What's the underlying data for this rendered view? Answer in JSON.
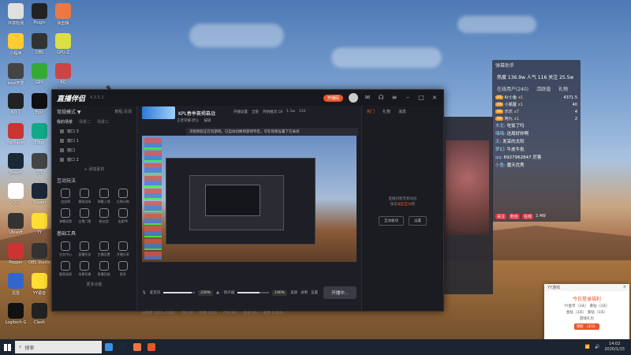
{
  "desktop": {
    "icons": [
      {
        "label": "环境检测",
        "color": "#e0e0e0"
      },
      {
        "label": "小程序",
        "color": "#ffcc33"
      },
      {
        "label": "Intel开发",
        "color": "#444"
      },
      {
        "label": "NO.1",
        "color": "#222"
      },
      {
        "label": "PotPlayer",
        "color": "#c33"
      },
      {
        "label": "Steam",
        "color": "#1b2838"
      },
      {
        "label": "QQ",
        "color": "#fff"
      },
      {
        "label": "Ubisoft",
        "color": "#333"
      },
      {
        "label": "Pepper",
        "color": "#c33"
      },
      {
        "label": "迅雷",
        "color": "#36c"
      },
      {
        "label": "Logitech G",
        "color": "#111"
      },
      {
        "label": "Plugin",
        "color": "#222"
      },
      {
        "label": "OBS",
        "color": "#333"
      },
      {
        "label": "GPU",
        "color": "#3a3"
      },
      {
        "label": "Epic",
        "color": "#111"
      },
      {
        "label": "Edge",
        "color": "#1a8"
      },
      {
        "label": "Q3",
        "color": "#444"
      },
      {
        "label": "Steam",
        "color": "#1b2838"
      },
      {
        "label": "YY",
        "color": "#ffdd33"
      },
      {
        "label": "OBS Studio",
        "color": "#333"
      },
      {
        "label": "YY语音",
        "color": "#ffdd33"
      },
      {
        "label": "Clash",
        "color": "#222"
      },
      {
        "label": "快剪辑",
        "color": "#e74"
      },
      {
        "label": "GPU-Z",
        "color": "#dd4"
      },
      {
        "label": "BG",
        "color": "#c44"
      },
      {
        "label": "3D",
        "color": "#333"
      },
      {
        "label": "Game",
        "color": "#c33"
      },
      {
        "label": "网易云音乐",
        "color": "#d33"
      },
      {
        "label": "直播姬",
        "color": "#3a8fe0"
      },
      {
        "label": "微信",
        "color": "#2a3"
      },
      {
        "label": "文档",
        "color": "#e74"
      }
    ]
  },
  "app": {
    "brand": "直播伴侣",
    "version": "4.3.5.2",
    "live_pill": "开播码",
    "left": {
      "section1_title": "常规模式 ▼",
      "section1_links": "教程 反馈",
      "tabs": [
        "我的场景",
        "场景二",
        "场景三"
      ],
      "scenes": [
        "窗口 3",
        "窗口 1",
        "窗口",
        "窗口 2"
      ],
      "add_source": "+ 添加素材",
      "section2_title": "互动玩法",
      "interact_tools": [
        "加加榜",
        "模拟战场",
        "弹幕上墙",
        "礼物计数",
        "弹幕投票",
        "全景门票",
        "粉丝团",
        "连麦PK"
      ],
      "section3_title": "基础工具",
      "basic_tools": [
        "任务中心",
        "直播任务",
        "主播设置",
        "开播分享",
        "截图录屏",
        "场景切换",
        "直播回放",
        "更多"
      ],
      "more": "更多功能"
    },
    "center": {
      "stream_name": "KPL春季赛揭幕战",
      "sub_info": [
        "王者荣耀·默认",
        "编辑"
      ],
      "stats": [
        "开播设置",
        "全部",
        "开始推流 18",
        "1.1w",
        "133"
      ],
      "notice": "识别到您正在玩游戏，已自动切换到游戏专区，可在场景设置下方关闭",
      "mic_label": "麦克风",
      "mic_value": "230%",
      "speaker_label": "扬声器",
      "speaker_value": "100%",
      "mic_level": 0.9,
      "speaker_level": 0.7,
      "ctrl_icons": [
        "美颜",
        "录制",
        "设置"
      ],
      "live_button": "开播中...",
      "status": [
        "分辨率 1920×1080",
        "FPS 60",
        "码率 2500",
        "CPU 8%",
        "丢帧 0%",
        "帧率 0.00%"
      ]
    },
    "right": {
      "tabs": [
        "热门",
        "礼物",
        "消息"
      ],
      "empty_line1": "直播间暂无新动态",
      "empty_line2": "快去",
      "empty_link": "发起互动",
      "empty_line3": "吧",
      "btns": [
        "互动板块",
        "设置"
      ]
    }
  },
  "overlay": {
    "header": "弹幕助手",
    "stats": "热度 136.9w  人气 116  关注 25.5w",
    "tabs": [
      "在线用户(240)",
      "活跃值",
      "礼物"
    ],
    "gifts": [
      {
        "lvl": "21",
        "name": "Kr小鱼",
        "gift": "x1",
        "num": "4371.5"
      },
      {
        "lvl": "33",
        "name": "小狐狸",
        "gift": "x1",
        "num": "40"
      },
      {
        "lvl": "19",
        "name": "乐乐",
        "gift": "x7",
        "num": "4"
      },
      {
        "lvl": "18",
        "name": "阿九",
        "gift": "x1",
        "num": "2"
      }
    ],
    "chats": [
      {
        "u": "木北",
        "m": "吃饭了吗"
      },
      {
        "u": "嗨嗨",
        "m": "这局好帅啊"
      },
      {
        "u": "天",
        "m": "发呆的太阳"
      },
      {
        "u": "梦幻",
        "m": "牛皮牛批"
      },
      {
        "u": "qq",
        "m": "6927962847 厉害"
      },
      {
        "u": "小鱼",
        "m": "魔天优秀"
      }
    ],
    "foot": [
      "关注",
      "粉丝",
      "在线",
      "2.4W"
    ]
  },
  "notification": {
    "app": "YY游戏",
    "title": "今日登录福利",
    "lines": [
      "YY金币（3天） 黄钻（3天）",
      "金钻（3天） 紫钻（3天）",
      "游戏礼包"
    ],
    "button": "领取 （3/3）"
  },
  "taskbar": {
    "search": "搜索",
    "time": "14:02",
    "date": "2020/1/15",
    "icons": [
      {
        "color": "#3a8fe0"
      },
      {
        "color": "#1b2838"
      },
      {
        "color": "#e74"
      },
      {
        "color": "#e7562a"
      }
    ]
  }
}
